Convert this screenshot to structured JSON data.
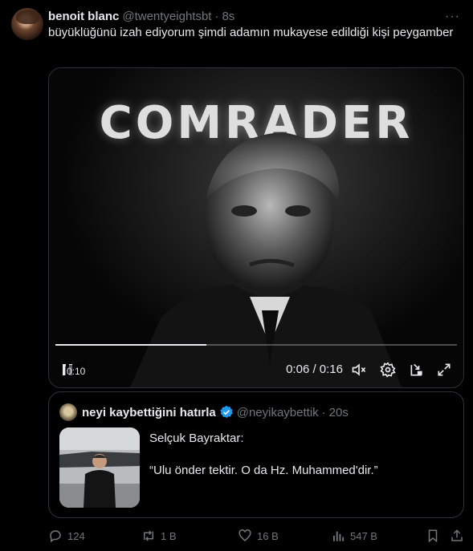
{
  "tweet": {
    "display_name": "benoit blanc",
    "handle": "@twentyeightsbt",
    "separator": "·",
    "time": "8s",
    "more_label": "···",
    "text": "büyüklüğünü izah ediyorum şimdi adamın mukayese edildiği kişi peygamber"
  },
  "video": {
    "overlay_text": "COMRADER",
    "badge_time": "0:10",
    "time_display": "0:06 / 0:16",
    "progress": 0.375,
    "icons": [
      "pause-icon",
      "volume-muted-icon",
      "settings-icon",
      "picture-in-picture-icon",
      "fullscreen-icon"
    ]
  },
  "quote": {
    "display_name": "neyi kaybettiğini hatırla",
    "handle": "@neyikaybettik",
    "separator": "·",
    "time": "20s",
    "lines": [
      "Selçuk Bayraktar:",
      "",
      "“Ulu önder tektir. O da Hz. Muhammed'dir.”"
    ]
  },
  "actions": {
    "replies": "124",
    "retweets": "1 B",
    "likes": "16 B",
    "views": "547 B"
  },
  "colors": {
    "background": "#000000",
    "text": "#e7e9ea",
    "muted": "#71767b",
    "border": "#2f3336",
    "verified": "#1d9bf0"
  }
}
